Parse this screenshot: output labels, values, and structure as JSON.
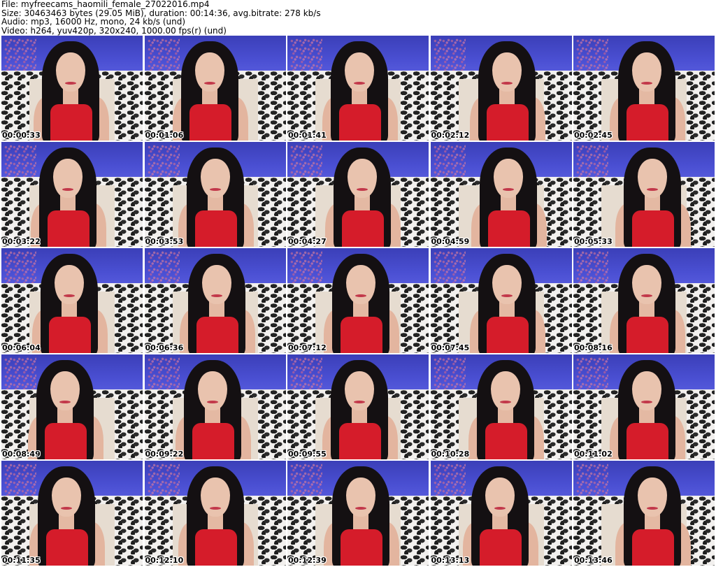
{
  "header": {
    "file_line": "File: myfreecams_haomili_female_27022016.mp4",
    "size_line": "Size: 30463463 bytes (29.05 MiB), duration: 00:14:36, avg.bitrate: 278 kb/s",
    "audio_line": "Audio: mp3, 16000 Hz, mono, 24 kb/s (und)",
    "video_line": "Video: h264, yuv420p, 320x240, 1000.00 fps(r) (und)"
  },
  "colors": {
    "wall": "#4a4fd2",
    "top": "#d51c2a",
    "hair": "#141012"
  },
  "thumbnails": [
    {
      "timestamp": "00:00:33"
    },
    {
      "timestamp": "00:01:06"
    },
    {
      "timestamp": "00:01:41"
    },
    {
      "timestamp": "00:02:12"
    },
    {
      "timestamp": "00:02:45"
    },
    {
      "timestamp": "00:03:22"
    },
    {
      "timestamp": "00:03:53"
    },
    {
      "timestamp": "00:04:27"
    },
    {
      "timestamp": "00:04:59"
    },
    {
      "timestamp": "00:05:33"
    },
    {
      "timestamp": "00:06:04"
    },
    {
      "timestamp": "00:06:36"
    },
    {
      "timestamp": "00:07:12"
    },
    {
      "timestamp": "00:07:45"
    },
    {
      "timestamp": "00:08:16"
    },
    {
      "timestamp": "00:08:49"
    },
    {
      "timestamp": "00:09:22"
    },
    {
      "timestamp": "00:09:55"
    },
    {
      "timestamp": "00:10:28"
    },
    {
      "timestamp": "00:11:02"
    },
    {
      "timestamp": "00:11:35"
    },
    {
      "timestamp": "00:12:10"
    },
    {
      "timestamp": "00:12:39"
    },
    {
      "timestamp": "00:13:13"
    },
    {
      "timestamp": "00:13:46"
    }
  ]
}
